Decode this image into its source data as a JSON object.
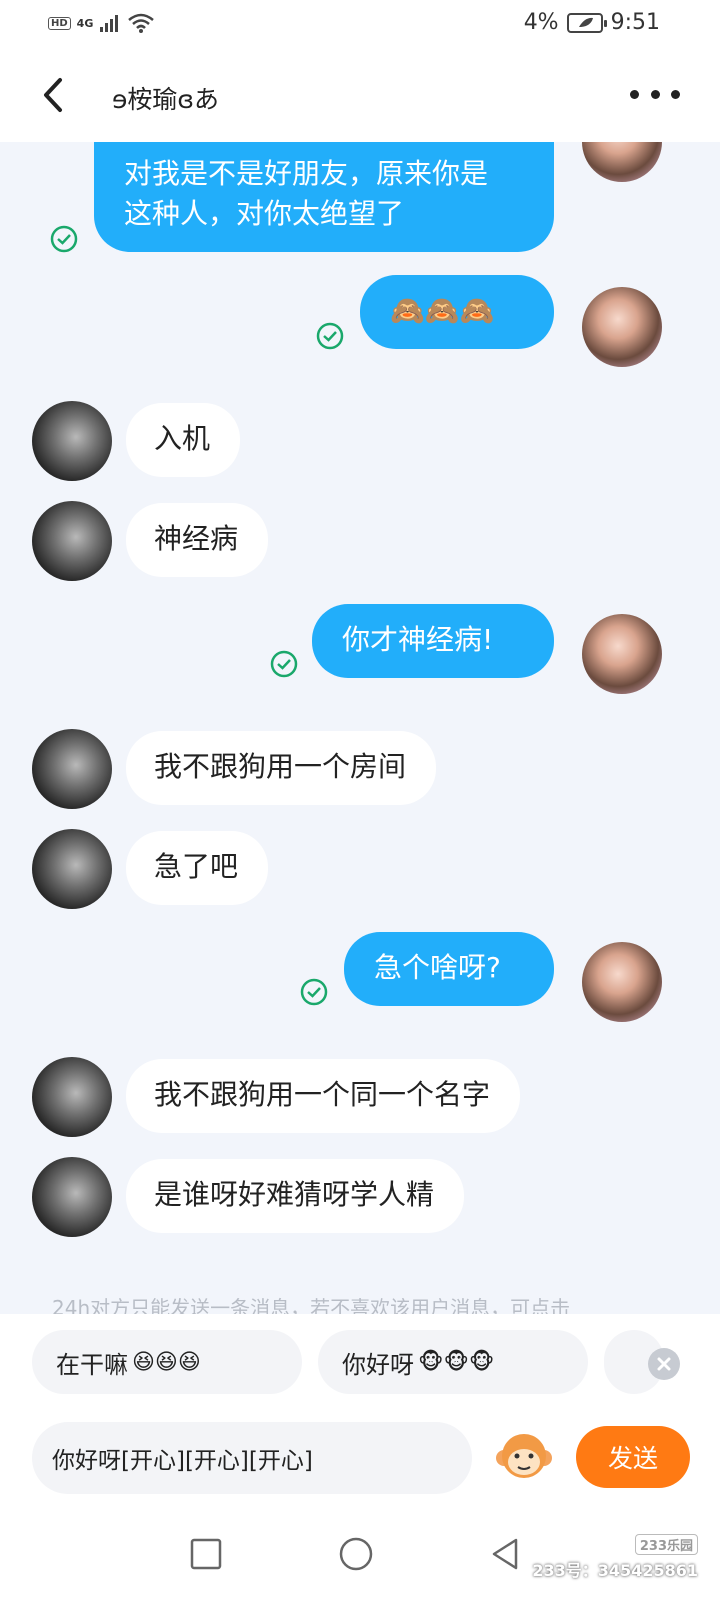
{
  "status_bar": {
    "hd": "HD",
    "network": "4G",
    "battery_text": "4%",
    "time": "9:51"
  },
  "header": {
    "title": "ɘ桉瑜ɞあ"
  },
  "messages": [
    {
      "id": "m1",
      "side": "out",
      "text_line1": "对我是不是好朋友，原来你是",
      "text_line2": "这种人，对你太绝望了"
    },
    {
      "id": "m2",
      "side": "out",
      "text": "🙈🙈🙈"
    },
    {
      "id": "m3",
      "side": "in",
      "text": "入机"
    },
    {
      "id": "m4",
      "side": "in",
      "text": "神经病"
    },
    {
      "id": "m5",
      "side": "out",
      "text": "你才神经病!"
    },
    {
      "id": "m6",
      "side": "in",
      "text": "我不跟狗用一个房间"
    },
    {
      "id": "m7",
      "side": "in",
      "text": "急了吧"
    },
    {
      "id": "m8",
      "side": "out",
      "text": "急个啥呀?"
    },
    {
      "id": "m9",
      "side": "in",
      "text": "我不跟狗用一个同一个名字"
    },
    {
      "id": "m10",
      "side": "in",
      "text": "是谁呀好难猜呀学人精"
    }
  ],
  "notice": "24h对方只能发送一条消息，若不喜欢该用户消息，可点击",
  "quick_replies": [
    {
      "text": "在干嘛",
      "emoji": "😆😆😆"
    },
    {
      "text": "你好呀",
      "emoji": "🐵🐵🐵"
    }
  ],
  "input": {
    "value": "你好呀[开心][开心][开心]",
    "send_label": "发送"
  },
  "watermark": {
    "logo": "233乐园",
    "text": "233号：345425861"
  },
  "colors": {
    "bubble_out": "#22aefa",
    "bubble_in": "#ffffff",
    "send_button": "#ff7a13",
    "read_check": "#1aa86b",
    "background": "#f2f5fb"
  }
}
